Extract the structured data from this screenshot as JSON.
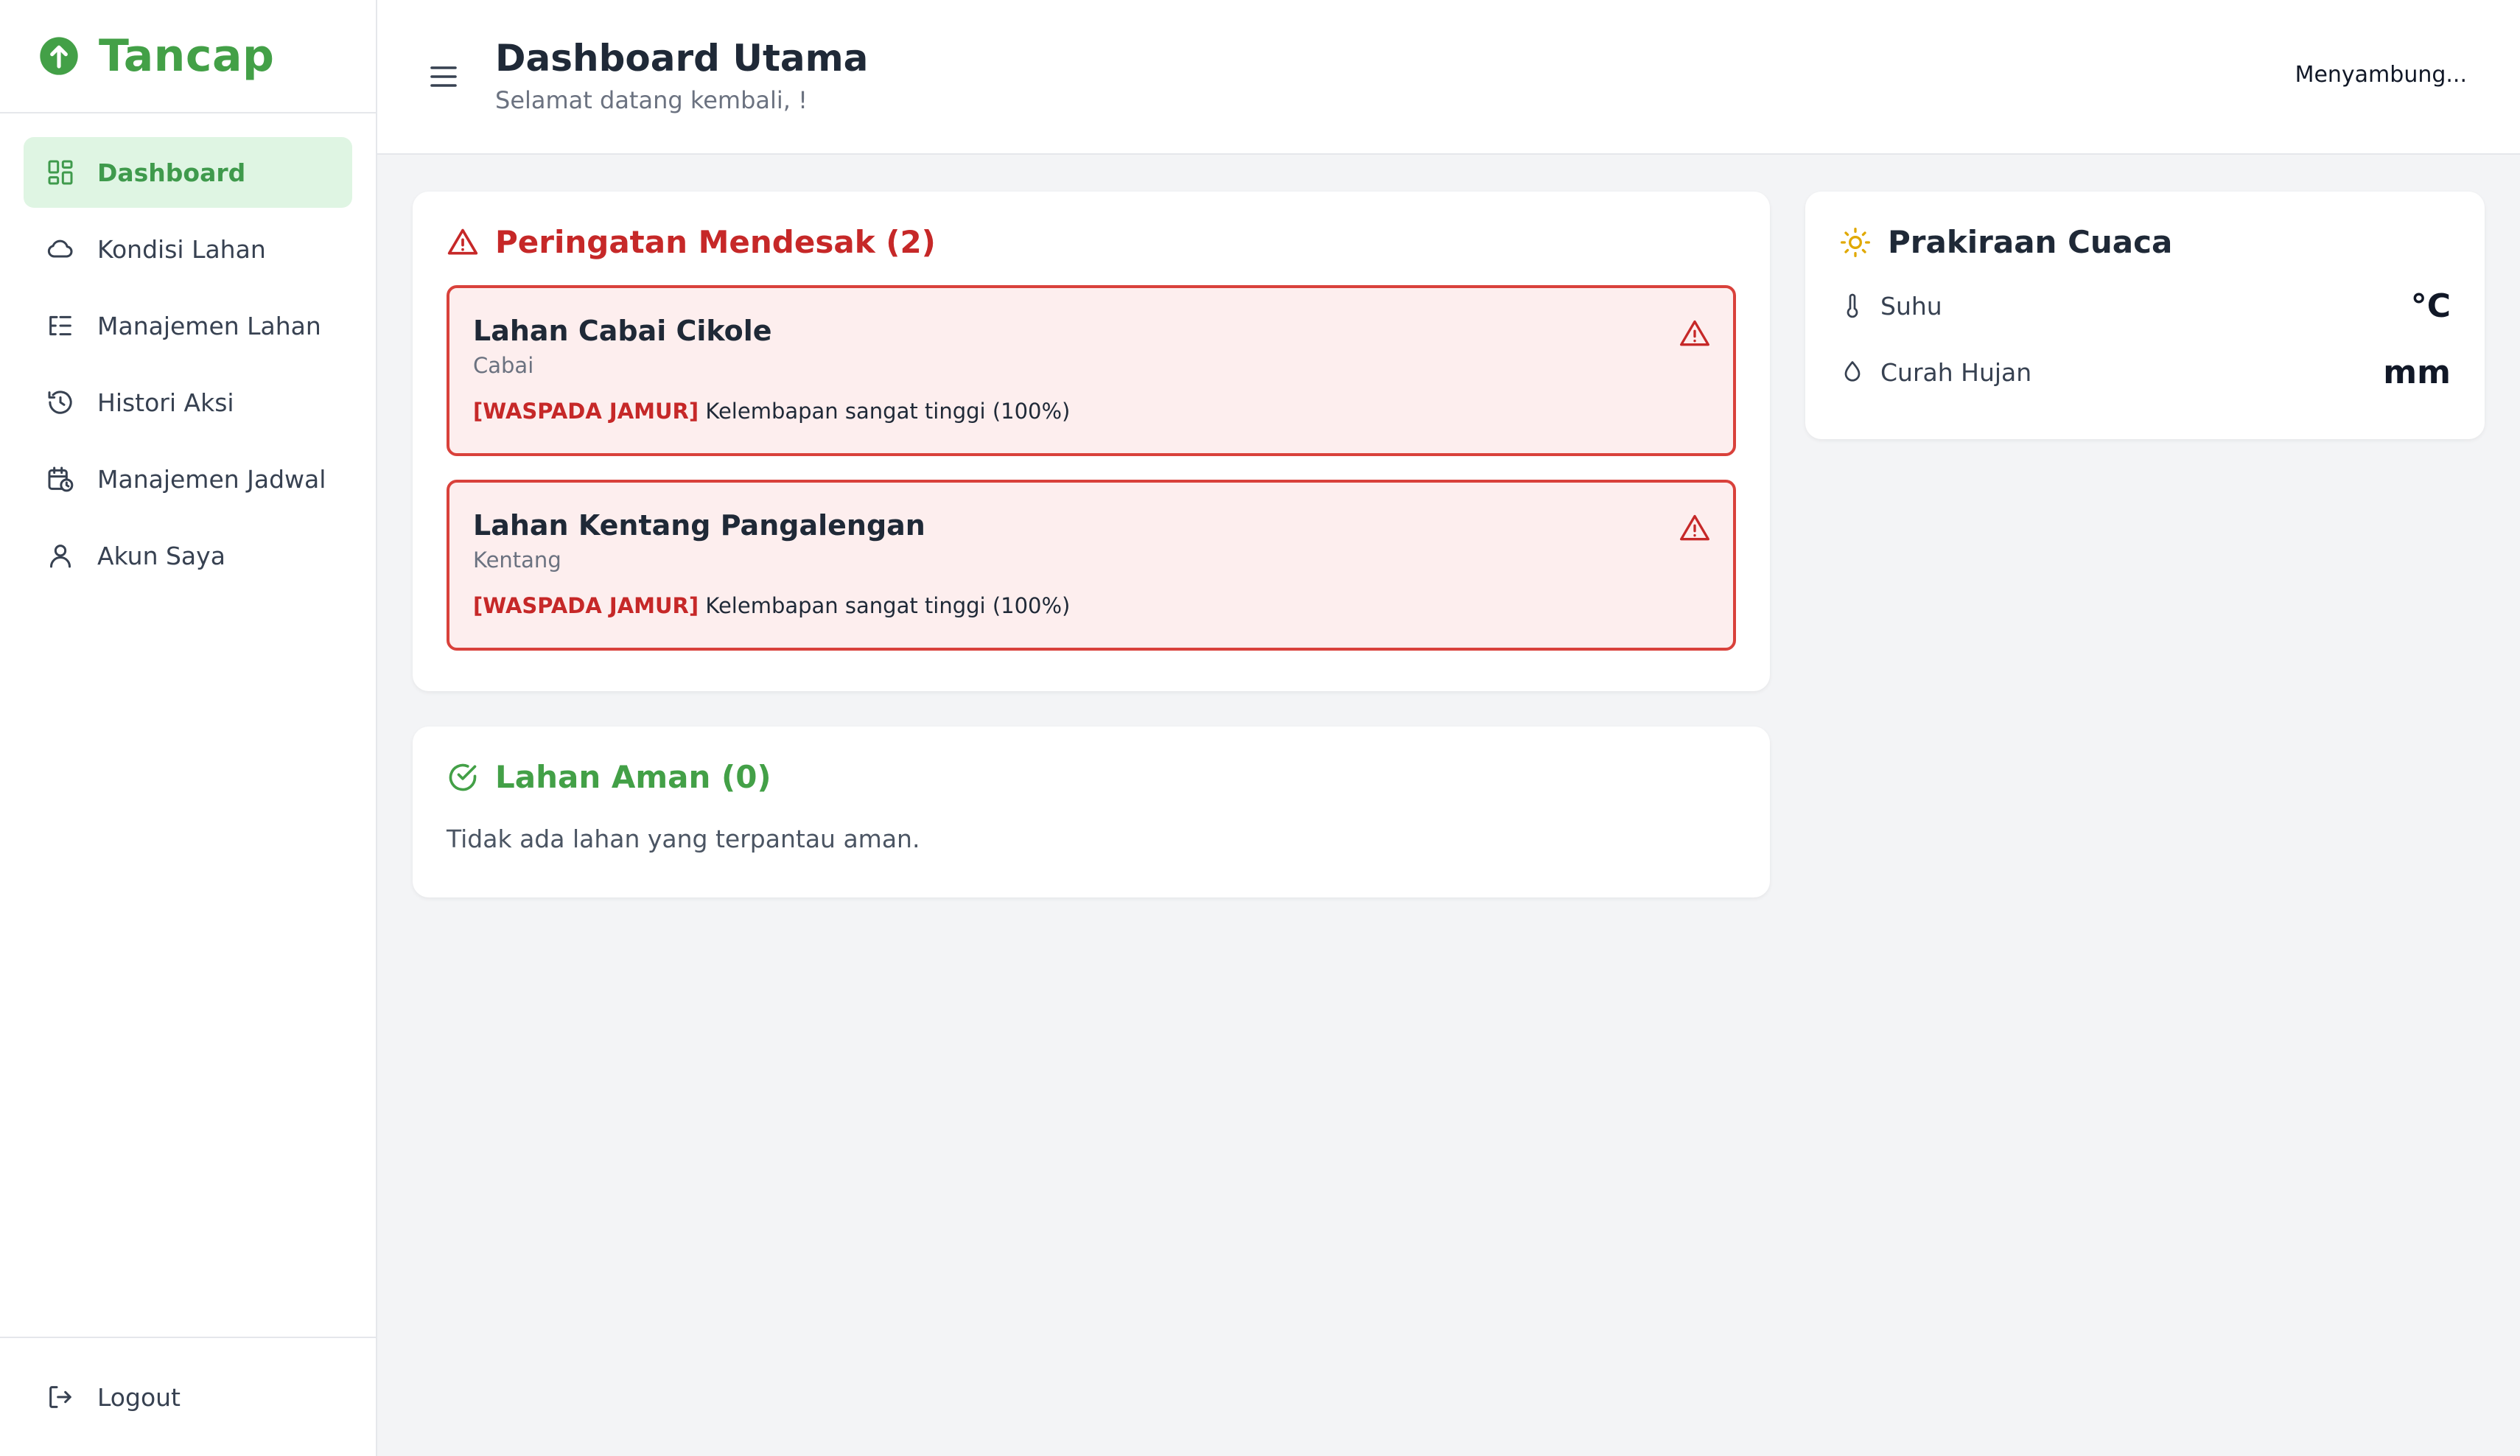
{
  "brand": {
    "name": "Tancap",
    "color": "#43a047"
  },
  "sidebar": {
    "items": [
      {
        "label": "Dashboard",
        "icon": "dashboard-grid-icon",
        "active": true
      },
      {
        "label": "Kondisi Lahan",
        "icon": "cloud-icon",
        "active": false
      },
      {
        "label": "Manajemen Lahan",
        "icon": "list-tree-icon",
        "active": false
      },
      {
        "label": "Histori Aksi",
        "icon": "history-icon",
        "active": false
      },
      {
        "label": "Manajemen Jadwal",
        "icon": "calendar-clock-icon",
        "active": false
      },
      {
        "label": "Akun Saya",
        "icon": "user-icon",
        "active": false
      }
    ],
    "logout_label": "Logout"
  },
  "header": {
    "title": "Dashboard Utama",
    "subtitle": "Selamat datang kembali, !",
    "connection_status": "Menyambung..."
  },
  "warnings": {
    "title": "Peringatan Mendesak (2)",
    "items": [
      {
        "name": "Lahan Cabai Cikole",
        "crop": "Cabai",
        "tag": "[WASPADA JAMUR]",
        "message": "Kelembapan sangat tinggi (100%)"
      },
      {
        "name": "Lahan Kentang Pangalengan",
        "crop": "Kentang",
        "tag": "[WASPADA JAMUR]",
        "message": "Kelembapan sangat tinggi (100%)"
      }
    ]
  },
  "safe": {
    "title": "Lahan Aman (0)",
    "empty_text": "Tidak ada lahan yang terpantau aman."
  },
  "weather": {
    "title": "Prakiraan Cuaca",
    "rows": [
      {
        "label": "Suhu",
        "value": "°C",
        "icon": "thermometer-icon"
      },
      {
        "label": "Curah Hujan",
        "value": "mm",
        "icon": "droplet-icon"
      }
    ]
  },
  "colors": {
    "accent_green": "#43a047",
    "active_bg": "#dff5e3",
    "danger_red": "#c62828",
    "alert_bg": "#fdeeee",
    "sun_yellow": "#e0a800"
  }
}
